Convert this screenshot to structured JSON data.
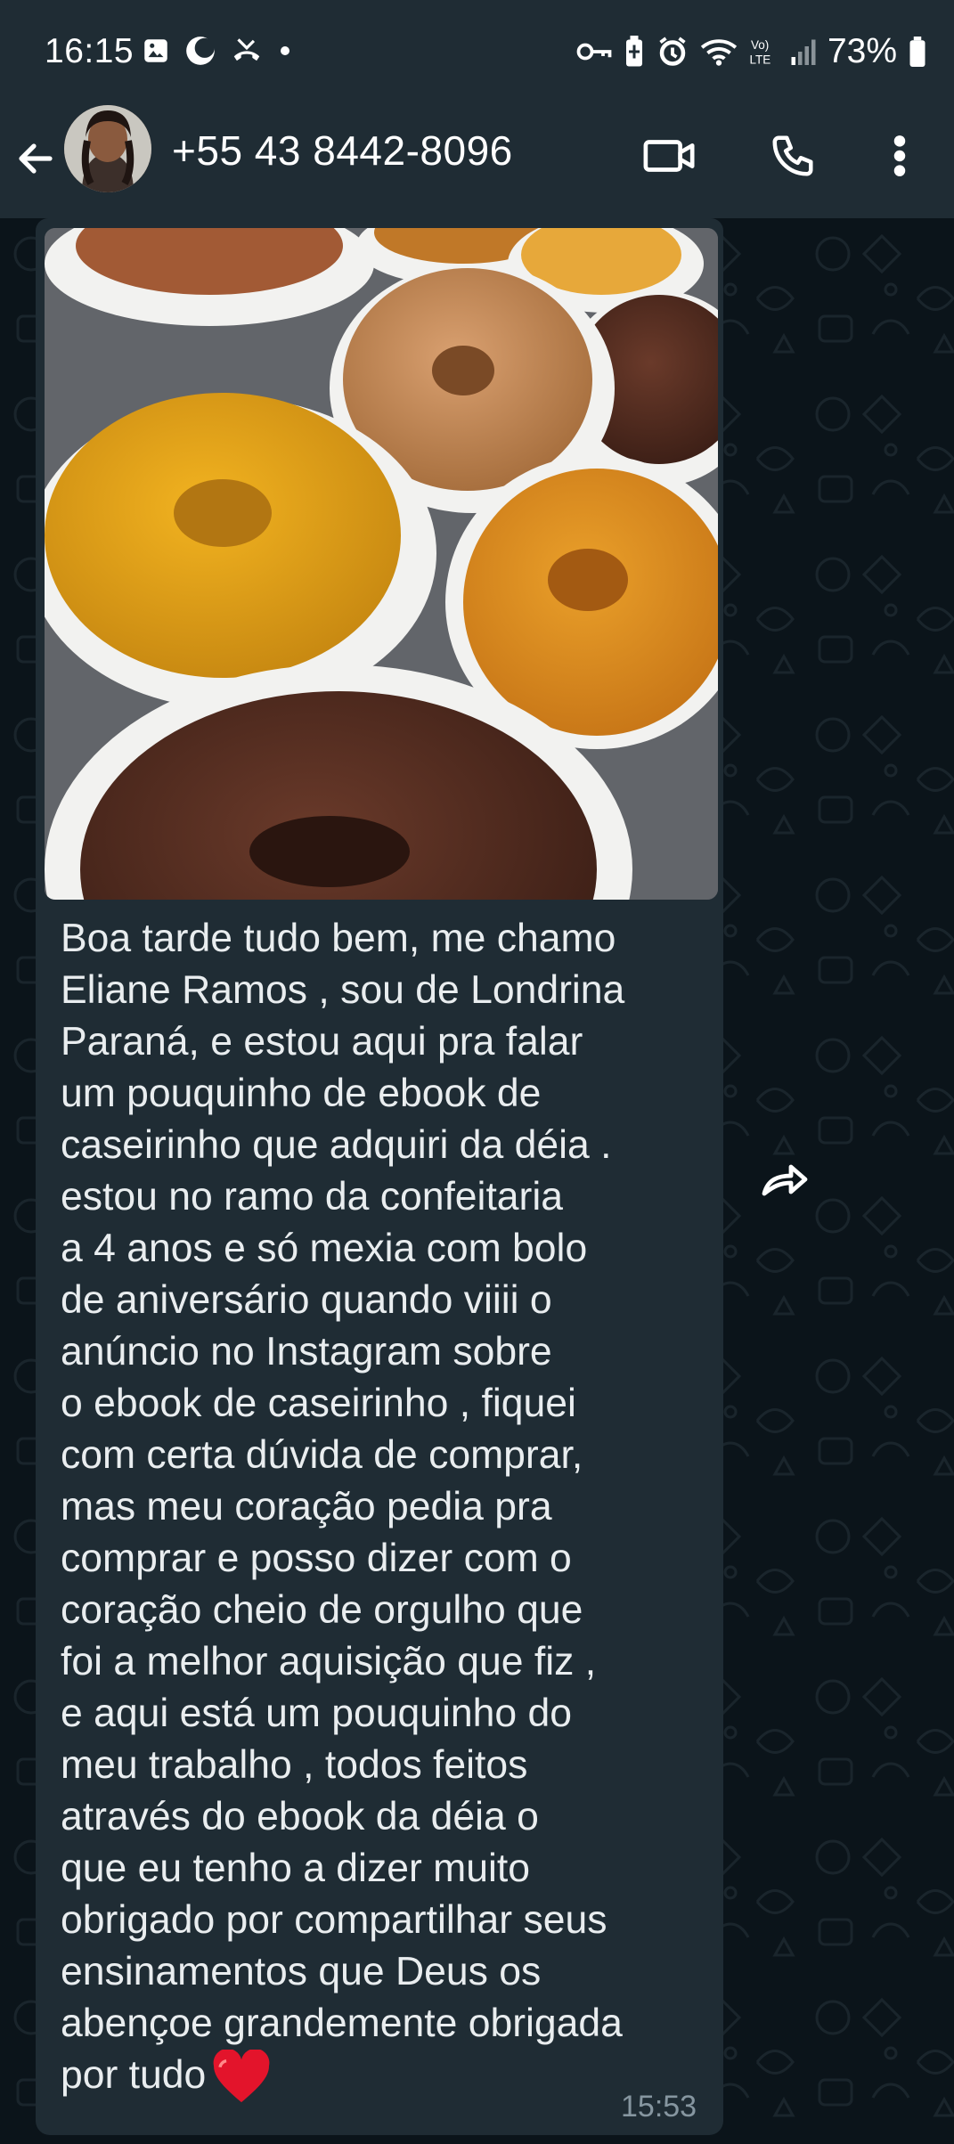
{
  "status_bar": {
    "time": "16:15",
    "battery": "73%",
    "left_icons": [
      "gallery-icon",
      "moon-icon",
      "missed-call-icon",
      "dot-icon"
    ],
    "right_icons": [
      "key-icon",
      "battery-saver-icon",
      "alarm-icon",
      "wifi-icon",
      "volte-icon",
      "signal-icon",
      "battery-icon"
    ]
  },
  "app_bar": {
    "contact": "+55 43 8442-8096",
    "icons": [
      "back-arrow-icon",
      "video-call-icon",
      "voice-call-icon",
      "more-vert-icon"
    ]
  },
  "message": {
    "text": "Boa tarde tudo bem, me chamo\nEliane Ramos , sou de Londrina\nParaná, e estou aqui pra falar\num pouquinho de ebook de\ncaseirinho que adquiri da déia .\nestou no ramo da confeitaria\na 4 anos e só mexia com bolo\nde aniversário quando viiii o\nanúncio no Instagram sobre\no ebook de caseirinho , fiquei\ncom certa dúvida de comprar,\nmas meu coração pedia pra\ncomprar e posso dizer com o\ncoração cheio de orgulho que\nfoi a melhor aquisição que fiz ,\ne aqui está um pouquinho do\nmeu trabalho , todos feitos\natravés do ebook da déia o\nque eu tenho a dizer muito\nobrigado por compartilhar seus\nensinamentos que Deus os\nabençoe grandemente obrigada\npor tudo",
    "emoji": "red-heart-icon",
    "time": "15:53",
    "image": "photo of bundt cakes on plates"
  },
  "colors": {
    "header_bg": "#1f2c34",
    "chat_bg": "#0b141a",
    "bubble_bg": "#1f2c34",
    "text": "#e9edef",
    "timestamp": "#8696a0"
  }
}
